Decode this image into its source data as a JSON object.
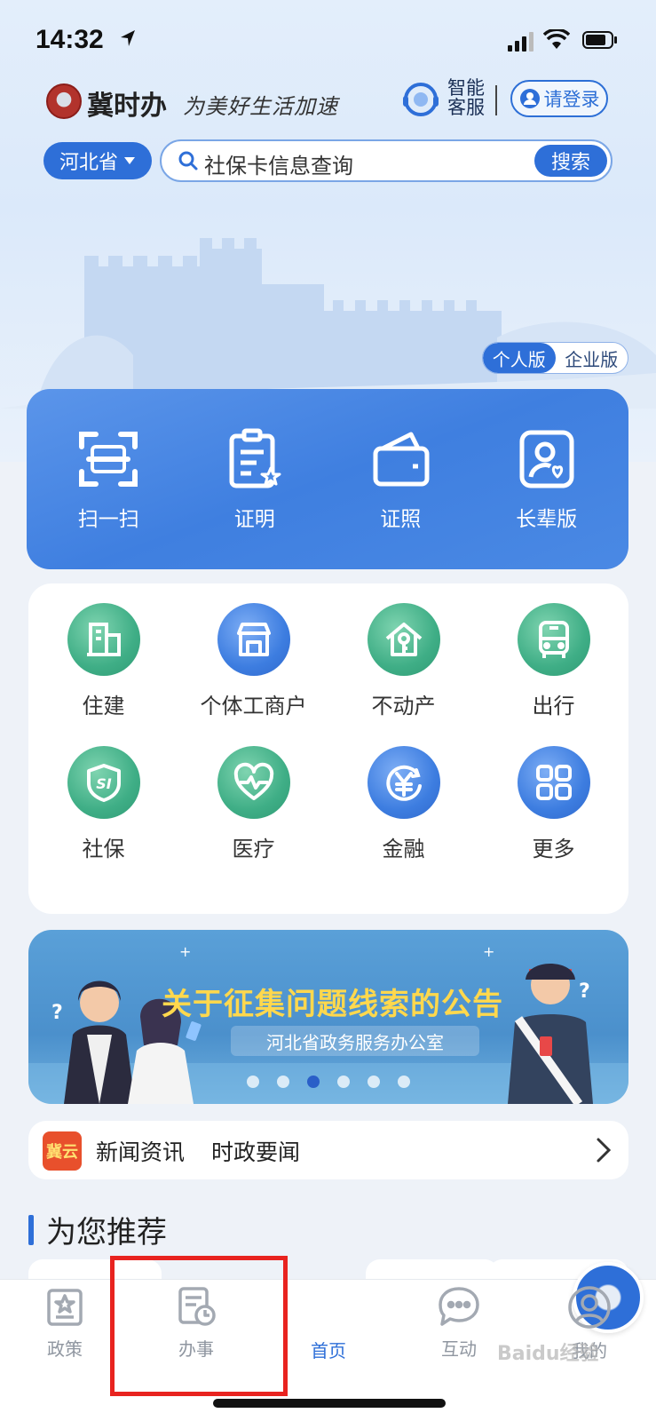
{
  "status_bar": {
    "time": "14:32"
  },
  "header": {
    "app_name": "冀时办",
    "slogan": "为美好生活加速",
    "customer_service_label": "智能客服",
    "login_label": "请登录"
  },
  "search": {
    "province": "河北省",
    "query": "社保卡信息查询",
    "button_label": "搜索"
  },
  "version_toggle": {
    "options": [
      "个人版",
      "企业版"
    ],
    "active": "个人版"
  },
  "quick_actions": [
    {
      "label": "扫一扫",
      "icon": "scan-icon"
    },
    {
      "label": "证明",
      "icon": "certificate-icon"
    },
    {
      "label": "证照",
      "icon": "wallet-icon"
    },
    {
      "label": "长辈版",
      "icon": "elder-icon"
    }
  ],
  "services": [
    {
      "label": "住建",
      "icon": "building-icon",
      "color": "#3fae86"
    },
    {
      "label": "个体工商户",
      "icon": "shop-icon",
      "color": "#3d7de0"
    },
    {
      "label": "不动产",
      "icon": "house-key-icon",
      "color": "#3fae86"
    },
    {
      "label": "出行",
      "icon": "bus-icon",
      "color": "#3fae86"
    },
    {
      "label": "社保",
      "icon": "social-security-icon",
      "color": "#3fae86"
    },
    {
      "label": "医疗",
      "icon": "heart-pulse-icon",
      "color": "#3fae86"
    },
    {
      "label": "金融",
      "icon": "yuan-icon",
      "color": "#3d7de0"
    },
    {
      "label": "更多",
      "icon": "grid-icon",
      "color": "#3d7de0"
    }
  ],
  "banner": {
    "title": "关于征集问题线索的公告",
    "subtitle": "河北省政务服务办公室",
    "page_count": 6,
    "active_page": 3
  },
  "news": {
    "badge": "冀云",
    "item1": "新闻资讯",
    "item2": "时政要闻"
  },
  "recommend": {
    "title": "为您推荐"
  },
  "tabbar": [
    {
      "label": "政策",
      "icon": "policy-icon"
    },
    {
      "label": "办事",
      "icon": "tasks-icon"
    },
    {
      "label": "首页",
      "icon": "home-emblem-icon",
      "active": true
    },
    {
      "label": "互动",
      "icon": "chat-icon"
    },
    {
      "label": "我的",
      "icon": "profile-icon"
    }
  ],
  "colors": {
    "primary": "#2e6fd8",
    "green": "#3fae86",
    "highlight_box": "#e8231f"
  },
  "watermark": "Baidu经验"
}
